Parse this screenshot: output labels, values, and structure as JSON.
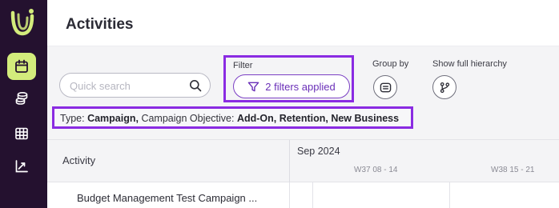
{
  "sidebar": {
    "logo_icon": "brand-logo-icon",
    "items": [
      {
        "name": "activities",
        "icon": "calendar-icon",
        "active": true
      },
      {
        "name": "budget",
        "icon": "coins-stack-icon",
        "active": false
      },
      {
        "name": "table",
        "icon": "grid-table-icon",
        "active": false
      },
      {
        "name": "analytics",
        "icon": "chart-trend-icon",
        "active": false
      }
    ],
    "colors": {
      "background": "#24112f",
      "active": "#d3ec7c"
    }
  },
  "header": {
    "title": "Activities"
  },
  "toolbar": {
    "search": {
      "placeholder": "Quick search",
      "value": ""
    },
    "filter": {
      "label": "Filter",
      "button_label": "2 filters applied"
    },
    "group_by": {
      "label": "Group by"
    },
    "hierarchy": {
      "label": "Show full hierarchy"
    },
    "summary": {
      "type_label": "Type:",
      "type_value": "Campaign,",
      "objective_label": "Campaign Objective:",
      "objective_value": "Add-On, Retention, New Business"
    }
  },
  "grid": {
    "activity_header": "Activity",
    "month": "Sep 2024",
    "weeks": [
      "W37 08 - 14",
      "W38 15 - 21"
    ],
    "rows": [
      {
        "label": "Budget Management Test Campaign ..."
      }
    ]
  },
  "colors": {
    "accent": "#7b3fc4",
    "highlight": "#8a2be2"
  }
}
